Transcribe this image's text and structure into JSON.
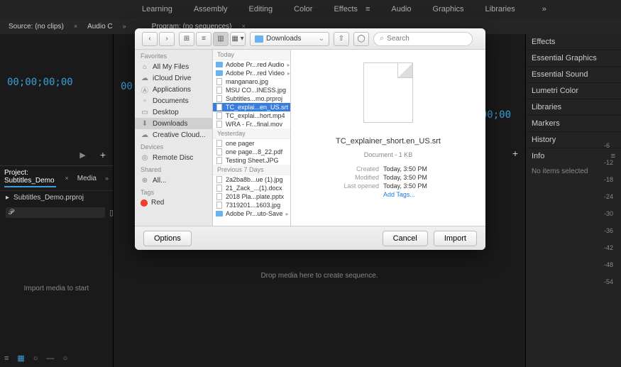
{
  "top_menu": {
    "items": [
      "Learning",
      "Assembly",
      "Editing",
      "Color",
      "Effects",
      "Audio",
      "Graphics",
      "Libraries"
    ],
    "active": "Effects"
  },
  "workspace": {
    "source_label": "Source: (no clips)",
    "audio_label": "Audio C",
    "program_label": "Program: (no sequences)"
  },
  "timecodes": {
    "left": "00;00;00;00",
    "center1": "00;00;00;00",
    "center2": "00;00;00;00"
  },
  "project": {
    "tab_project": "Project: Subtitles_Demo",
    "tab_media": "Media",
    "file_name": "Subtitles_Demo.prproj",
    "search_placeholder": "",
    "import_hint": "Import media to start"
  },
  "center": {
    "drop_hint": "Drop media here to create sequence."
  },
  "right_panels": [
    "Effects",
    "Essential Graphics",
    "Essential Sound",
    "Lumetri Color",
    "Libraries",
    "Markers",
    "History"
  ],
  "info_panel": {
    "title": "Info",
    "no_items": "No items selected"
  },
  "ruler": [
    "-6",
    "-12",
    "-18",
    "-24",
    "-30",
    "-36",
    "-42",
    "-48",
    "-54"
  ],
  "dialog": {
    "location": "Downloads",
    "search_placeholder": "Search",
    "sidebar": {
      "favorites_hdr": "Favorites",
      "favorites": [
        "All My Files",
        "iCloud Drive",
        "Applications",
        "Documents",
        "Desktop",
        "Downloads",
        "Creative Cloud..."
      ],
      "fav_selected": "Downloads",
      "devices_hdr": "Devices",
      "devices": [
        "Remote Disc"
      ],
      "shared_hdr": "Shared",
      "shared": [
        "All..."
      ],
      "tags_hdr": "Tags",
      "tags": [
        "Red"
      ]
    },
    "files": {
      "today_hdr": "Today",
      "today": [
        {
          "name": "Adobe Pr...red Audio",
          "type": "folder"
        },
        {
          "name": "Adobe Pr...red Video",
          "type": "folder"
        },
        {
          "name": "manganaro.jpg",
          "type": "file"
        },
        {
          "name": "MSU CO...INESS.jpg",
          "type": "file"
        },
        {
          "name": "Subtitles...mo.prproj",
          "type": "file"
        },
        {
          "name": "TC_explai...en_US.srt",
          "type": "file",
          "selected": true
        },
        {
          "name": "TC_explai...hort.mp4",
          "type": "file"
        },
        {
          "name": "WRA - Fr...final.mov",
          "type": "file"
        }
      ],
      "yesterday_hdr": "Yesterday",
      "yesterday": [
        {
          "name": "one pager",
          "type": "file"
        },
        {
          "name": "one page...8_22.pdf",
          "type": "file"
        },
        {
          "name": "Testing Sheet.JPG",
          "type": "file"
        }
      ],
      "prev7_hdr": "Previous 7 Days",
      "prev7": [
        {
          "name": "2a2ba8b...ue (1).jpg",
          "type": "file"
        },
        {
          "name": "21_Zack_...(1).docx",
          "type": "file"
        },
        {
          "name": "2018 Pla...plate.pptx",
          "type": "file"
        },
        {
          "name": "7319201...1603.jpg",
          "type": "file"
        },
        {
          "name": "Adobe Pr...uto-Save",
          "type": "folder"
        }
      ]
    },
    "preview": {
      "filename": "TC_explainer_short.en_US.srt",
      "kind": "Document - 1 KB",
      "created_label": "Created",
      "created": "Today, 3:50 PM",
      "modified_label": "Modified",
      "modified": "Today, 3:50 PM",
      "opened_label": "Last opened",
      "opened": "Today, 3:50 PM",
      "add_tags": "Add Tags..."
    },
    "footer": {
      "options": "Options",
      "cancel": "Cancel",
      "import": "Import"
    }
  }
}
